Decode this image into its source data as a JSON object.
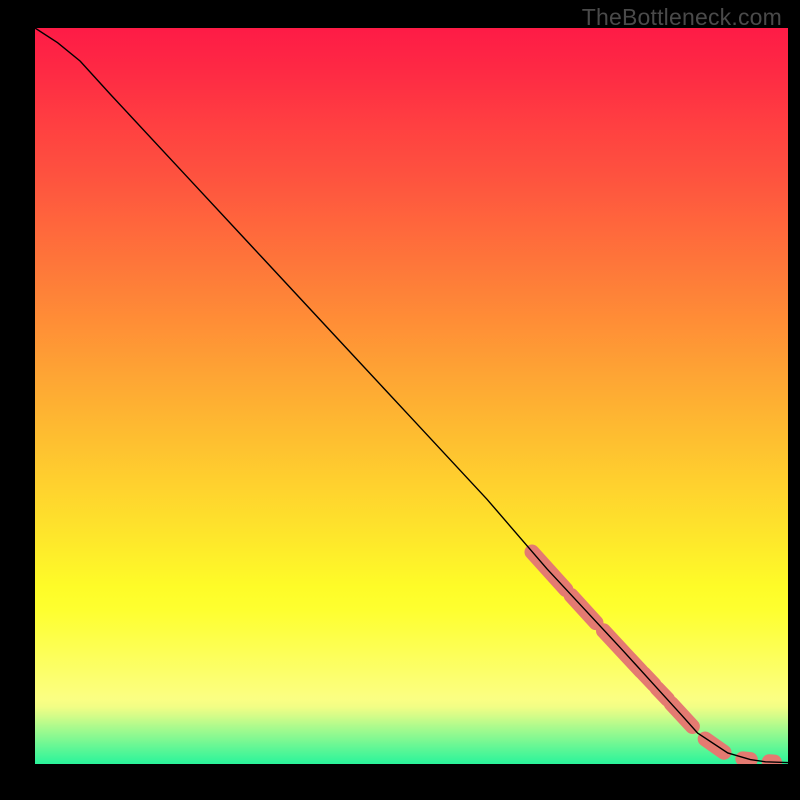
{
  "watermark": "TheBottleneck.com",
  "chart_data": {
    "type": "line",
    "title": "",
    "xlabel": "",
    "ylabel": "",
    "xlim": [
      0,
      100
    ],
    "ylim": [
      0,
      100
    ],
    "grid": false,
    "legend": false,
    "series": [
      {
        "name": "curve",
        "style": "line-thin-black",
        "x": [
          0,
          3,
          6,
          10,
          20,
          30,
          40,
          50,
          60,
          68,
          73,
          78,
          82,
          86,
          88,
          92,
          95,
          97,
          100
        ],
        "y": [
          100,
          98,
          95.5,
          91,
          80,
          69,
          58,
          47,
          36,
          26.5,
          21,
          15.5,
          11,
          6.5,
          4.2,
          1.5,
          0.6,
          0.3,
          0.2
        ]
      },
      {
        "name": "highlight-segments",
        "style": "thick-salmon-rounded",
        "segments": [
          {
            "x": [
              66,
              70.5
            ],
            "y": [
              28.8,
              23.7
            ]
          },
          {
            "x": [
              71.2,
              74.5
            ],
            "y": [
              22.9,
              19.2
            ]
          },
          {
            "x": [
              75.5,
              80.5
            ],
            "y": [
              18.1,
              12.6
            ]
          },
          {
            "x": [
              80.8,
              82.2
            ],
            "y": [
              12.3,
              10.8
            ]
          },
          {
            "x": [
              82.6,
              84.0
            ],
            "y": [
              10.3,
              8.8
            ]
          },
          {
            "x": [
              84.5,
              87.3
            ],
            "y": [
              8.2,
              5.1
            ]
          },
          {
            "x": [
              89.0,
              91.5
            ],
            "y": [
              3.4,
              1.6
            ]
          },
          {
            "x": [
              94.0,
              95.0
            ],
            "y": [
              0.7,
              0.6
            ]
          },
          {
            "x": [
              97.5,
              98.2
            ],
            "y": [
              0.3,
              0.25
            ]
          }
        ]
      }
    ],
    "background_gradient": {
      "stops": [
        {
          "offset": 0.0,
          "color": "#fe1b46"
        },
        {
          "offset": 0.06,
          "color": "#fe2a44"
        },
        {
          "offset": 0.13,
          "color": "#ff3f41"
        },
        {
          "offset": 0.2,
          "color": "#fe523f"
        },
        {
          "offset": 0.27,
          "color": "#ff673c"
        },
        {
          "offset": 0.34,
          "color": "#fe7c39"
        },
        {
          "offset": 0.4,
          "color": "#ff8e36"
        },
        {
          "offset": 0.47,
          "color": "#fea434"
        },
        {
          "offset": 0.54,
          "color": "#feb931"
        },
        {
          "offset": 0.62,
          "color": "#ffd12e"
        },
        {
          "offset": 0.69,
          "color": "#fee62b"
        },
        {
          "offset": 0.76,
          "color": "#fefc28"
        },
        {
          "offset": 0.79,
          "color": "#feff2f"
        },
        {
          "offset": 0.82,
          "color": "#fdff43"
        },
        {
          "offset": 0.85,
          "color": "#fdff58"
        },
        {
          "offset": 0.88,
          "color": "#fcff6d"
        },
        {
          "offset": 0.9,
          "color": "#fcff7b"
        },
        {
          "offset": 0.912,
          "color": "#fbff83"
        },
        {
          "offset": 0.922,
          "color": "#f2fe85"
        },
        {
          "offset": 0.933,
          "color": "#d8fc88"
        },
        {
          "offset": 0.943,
          "color": "#bdfb8b"
        },
        {
          "offset": 0.953,
          "color": "#a2fa8e"
        },
        {
          "offset": 0.964,
          "color": "#86f891"
        },
        {
          "offset": 0.974,
          "color": "#6bf794"
        },
        {
          "offset": 0.985,
          "color": "#4ff697"
        },
        {
          "offset": 0.993,
          "color": "#3bf599"
        },
        {
          "offset": 1.0,
          "color": "#2af49b"
        }
      ]
    },
    "colors": {
      "line": "#000000",
      "highlight": "#e47a71",
      "frame": "#000000"
    }
  }
}
